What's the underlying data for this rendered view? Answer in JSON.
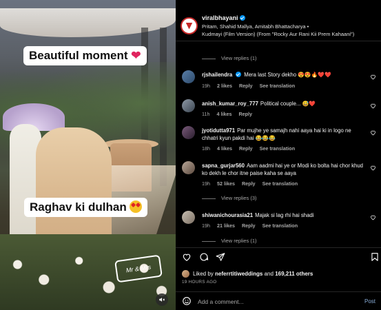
{
  "media": {
    "caption_top": "Beautiful moment",
    "caption_bottom": "Raghav ki dulhan",
    "sticker_text": "Mr & Mrs"
  },
  "post": {
    "username": "viralbhayani",
    "artists": "Pritam, Shahid Mallya, Amitabh Bhattacharya •",
    "song": "Kudmayi (Film Version) (From \"Rocky Aur Rani Kii Prem Kahaani\")"
  },
  "comments": {
    "view_replies_top": "View replies (1)",
    "items": [
      {
        "user": "rjshailendra",
        "verified": true,
        "text": "Mera last Story dekho",
        "emojis": "😍😍🔥❤️❤️",
        "time": "19h",
        "likes": "2 likes",
        "reply": "Reply",
        "see_translation": "See translation"
      },
      {
        "user": "anish_kumar_roy_777",
        "text": "Political couple...",
        "emojis": "😅❤️",
        "time": "11h",
        "likes": "4 likes",
        "reply": "Reply"
      },
      {
        "user": "jyotidutta971",
        "text": "Par mujhe ye samajh nahi aaya hai ki in logo ne chhatri kyun pakdi hai",
        "emojis": "😂😂😂",
        "time": "18h",
        "likes": "4 likes",
        "reply": "Reply",
        "see_translation": "See translation"
      },
      {
        "user": "sapna_gurjar560",
        "text": "Aam aadmi hai ye or Modi ko bolta hai chor khud ko dekh le chor itne paise kaha se aaya",
        "time": "19h",
        "likes": "52 likes",
        "reply": "Reply",
        "see_translation": "See translation",
        "view_replies": "View replies (3)"
      },
      {
        "user": "shiwanichourasia21",
        "text": "Majak si lag rhi hai shadi",
        "time": "19h",
        "likes": "21 likes",
        "reply": "Reply",
        "see_translation": "See translation",
        "view_replies": "View replies (1)"
      }
    ]
  },
  "footer": {
    "liked_by_prefix": "Liked by",
    "liked_by_user": "neferrtitiweddings",
    "liked_by_middle": "and",
    "liked_by_count": "169,211 others",
    "time_ago": "19 HOURS AGO",
    "add_comment_placeholder": "Add a comment...",
    "post_label": "Post"
  },
  "colors": {
    "background": "#000000",
    "muted_text": "#a8a8a8",
    "verified_blue": "#0095f6",
    "post_button": "#8aaed9",
    "divider": "#262626"
  }
}
